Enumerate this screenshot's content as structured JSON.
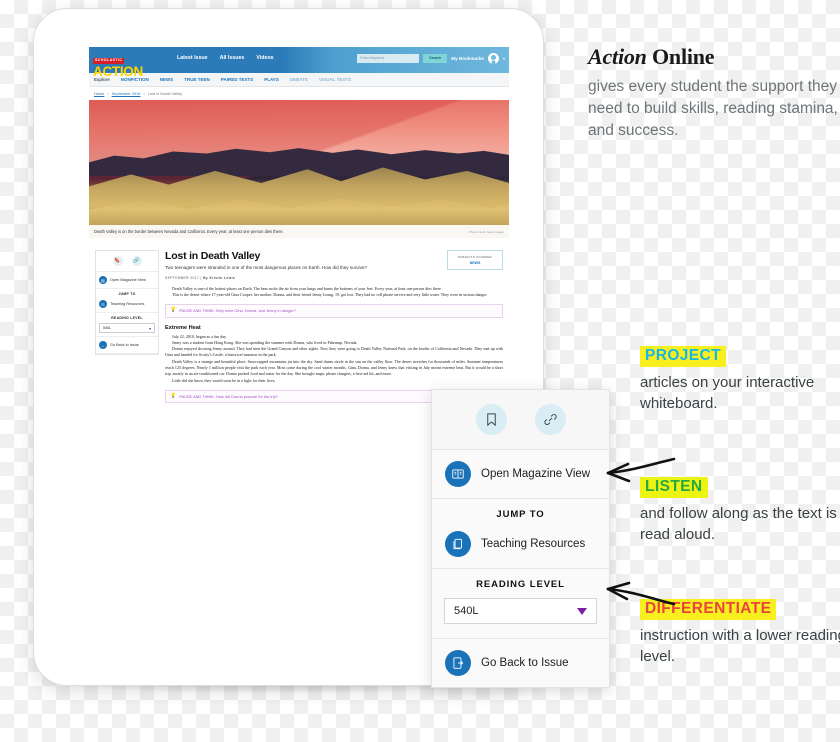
{
  "site": {
    "publisher": "SCHOLASTIC",
    "brand": "ACTION",
    "top_nav": [
      "Latest Issue",
      "All Issues",
      "Videos"
    ],
    "search_placeholder": "Enter Keyword",
    "search_button": "Search",
    "bookmarks_label": "My Bookmarks",
    "avatar_caret": "▾",
    "sub_nav_label": "Explore",
    "sub_nav": [
      "NONFICTION",
      "NEWS",
      "TRUE TEEN",
      "PAIRED TEXTS",
      "PLAYS",
      "DEBATE",
      "VISUAL TEXTS"
    ],
    "breadcrumb": [
      "Home",
      "September 2016",
      "Lost in Death Valley"
    ],
    "breadcrumb_sep": "›"
  },
  "hero": {
    "caption": "Death Valley is on the border between Nevada and California. Every year, at least one person dies there.",
    "credit": "Photo Credit: Getty Images"
  },
  "article": {
    "title": "Lost in Death Valley",
    "subtitle": "Two teenagers were stranded in one of the most dangerous places on Earth. How did they survive?",
    "date": "SEPTEMBER 2017",
    "byline": "By Kristin Lewis",
    "byline_sep": "|",
    "subjects_label": "SUBJECTS COVERED",
    "subjects_value": "NEWS",
    "paragraphs": [
      "Death Valley is one of the hottest places on Earth. The heat sucks the air from your lungs and burns the bottoms of your feet. Every year, at least one person dies there.",
      "This is the desert where 17-year-old Gina Cooper, her mother, Donna, and their friend Jenny Leung, 19, got lost. They had no cell phone service and very little water. They were in serious danger."
    ],
    "pause_one": "PAUSE AND THINK: Why were Gina, Donna, and Jenny in danger?",
    "section_heading": "Extreme Heat",
    "section_paragraphs": [
      "July 22, 2010, began as a fun day.",
      "Jenny was a student from Hong Kong. She was spending the summer with Donna, who lived in Pahrump, Nevada.",
      "Donna enjoyed showing Jenny around. They had seen the Grand Canyon and other sights. Now they were going to Death Valley National Park, on the border of California and Nevada. They met up with Gina and headed for Scotty's Castle, a historical mansion in the park.",
      "Death Valley is a strange and beautiful place. Snowcapped mountains jut into the sky. Sand dunes sizzle in the sun on the valley floor. The desert stretches for thousands of miles. Summer temperatures reach 125 degrees.   Nearly 1 million people visit the park each year. Most come during the cool winter months. Gina, Donna, and Jenny knew that visiting in July meant extreme heat. But it would be a short trip, mostly in an air-conditioned car. Donna packed food and water for the day. She brought maps, phone chargers, a first-aid kit, and more.",
      "Little did she know they would soon be in a fight for their lives."
    ],
    "pause_two": "PAUSE AND THINK: How did Donna prepare for the trip?"
  },
  "panel": {
    "bookmark_icon": "bookmark-icon",
    "link_icon": "link-icon",
    "magazine_label": "Open Magazine View",
    "jump_to_heading": "JUMP TO",
    "teaching_resources_label": "Teaching Resources",
    "reading_level_heading": "READING LEVEL",
    "reading_level_value": "540L",
    "go_back_label": "Go Back to Issue"
  },
  "marketing": {
    "heading_brand": "Action",
    "heading_rest": " Online",
    "body": "gives every student the support they need to build skills, reading stamina, and success.",
    "callouts": [
      {
        "keyword": "PROJECT",
        "keyword_color": "#18b5e8",
        "highlight_color": "#f7f01e",
        "text": "articles on your interactive whiteboard."
      },
      {
        "keyword": "LISTEN",
        "keyword_color": "#27a844",
        "highlight_color": "#eef411",
        "text": "and follow along as the text is read aloud."
      },
      {
        "keyword": "DIFFERENTIATE",
        "keyword_color": "#e8453c",
        "highlight_color": "#f7f01e",
        "text": "instruction with a lower reading level."
      }
    ]
  }
}
